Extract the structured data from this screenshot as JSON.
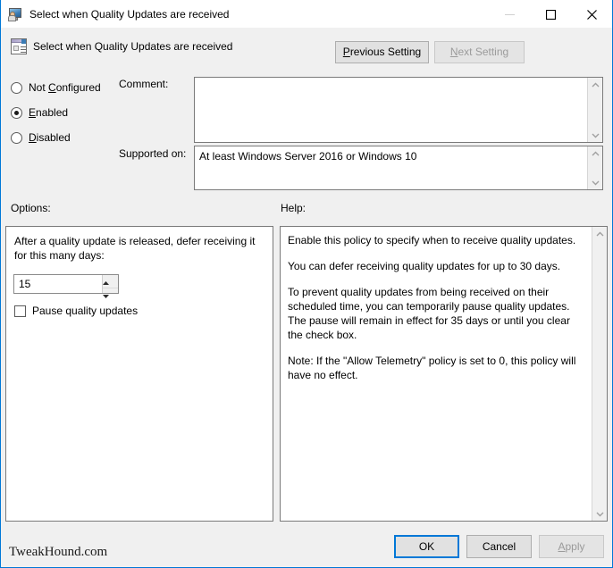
{
  "window": {
    "title": "Select when Quality Updates are received",
    "title_icon": "computer-user-icon",
    "minimize_label": "—",
    "maximize_label": "□",
    "close_label": "✕"
  },
  "header": {
    "policy_icon": "policy-setting-icon",
    "title": "Select when Quality Updates are received",
    "previous_setting": "Previous Setting",
    "previous_accel": "P",
    "next_setting": "Next Setting",
    "next_accel": "N",
    "next_enabled": false
  },
  "state": {
    "options": [
      {
        "label": "Not Configured",
        "accel": "C",
        "selected": false
      },
      {
        "label": "Enabled",
        "accel": "E",
        "selected": true
      },
      {
        "label": "Disabled",
        "accel": "D",
        "selected": false
      }
    ],
    "selected": "Enabled"
  },
  "comment": {
    "label": "Comment:",
    "value": "",
    "scroll_up_icon": "chevron-up-icon",
    "scroll_down_icon": "chevron-down-icon"
  },
  "supported_on": {
    "label": "Supported on:",
    "value": "At least Windows Server 2016 or Windows 10",
    "scroll_up_icon": "chevron-up-icon",
    "scroll_down_icon": "chevron-down-icon"
  },
  "options_panel": {
    "caption": "Options:",
    "defer_label": "After a quality update is released, defer receiving it for this many days:",
    "defer_value": "15",
    "spinner_up_icon": "spinner-up-icon",
    "spinner_down_icon": "spinner-down-icon",
    "pause_label": "Pause quality updates",
    "pause_checked": false
  },
  "help_panel": {
    "caption": "Help:",
    "paragraphs": [
      "Enable this policy to specify when to receive quality updates.",
      "You can defer receiving quality updates for up to 30 days.",
      "To prevent quality updates from being received on their scheduled time, you can temporarily pause quality updates. The pause will remain in effect for 35 days or until you clear the check box.",
      "Note: If the \"Allow Telemetry\" policy is set to 0, this policy will have no effect."
    ],
    "scroll_up_icon": "chevron-up-icon",
    "scroll_down_icon": "chevron-down-icon"
  },
  "footer": {
    "ok": "OK",
    "cancel": "Cancel",
    "apply": "Apply",
    "apply_accel": "A",
    "apply_enabled": false
  },
  "watermark": "TweakHound.com",
  "colors": {
    "accent": "#0078d7",
    "dialog_bg": "#f0f0f0",
    "field_bg": "#ffffff",
    "disabled_text": "#9b9b9b"
  }
}
